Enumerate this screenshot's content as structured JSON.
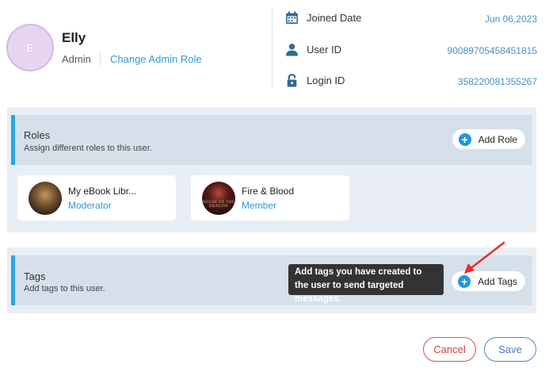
{
  "profile": {
    "avatar_letter": "E",
    "name": "Elly",
    "role": "Admin",
    "change_role_link": "Change Admin Role"
  },
  "info": {
    "joined_label": "Joined Date",
    "joined_value": "Jun 06,2023",
    "userid_label": "User ID",
    "userid_value": "90089705458451815",
    "login_label": "Login ID",
    "login_value": "358220081355267",
    "icons": [
      "calendar-icon",
      "user-icon",
      "lock-icon"
    ]
  },
  "roles_section": {
    "title": "Roles",
    "subtitle": "Assign different roles to this user.",
    "add_button": "Add Role",
    "cards": [
      {
        "title": "My eBook Libr...",
        "role": "Moderator"
      },
      {
        "title": "Fire & Blood",
        "role": "Member",
        "thumb_text": "HOUSE OF THE DRAGON"
      }
    ]
  },
  "tags_section": {
    "title": "Tags",
    "subtitle": "Add tags to this user.",
    "add_button": "Add Tags",
    "tooltip": "Add tags you have created to the user to send targeted messages."
  },
  "actions": {
    "cancel": "Cancel",
    "save": "Save"
  },
  "colors": {
    "accent": "#27a9e3",
    "link": "#2b9bd6",
    "plus_icon": "#1f97dd",
    "section_bg": "#e9eef5",
    "header_bg": "#d5e0ea",
    "cancel": "#d93c37",
    "save": "#3c7dc4",
    "arrow": "#e53125"
  }
}
